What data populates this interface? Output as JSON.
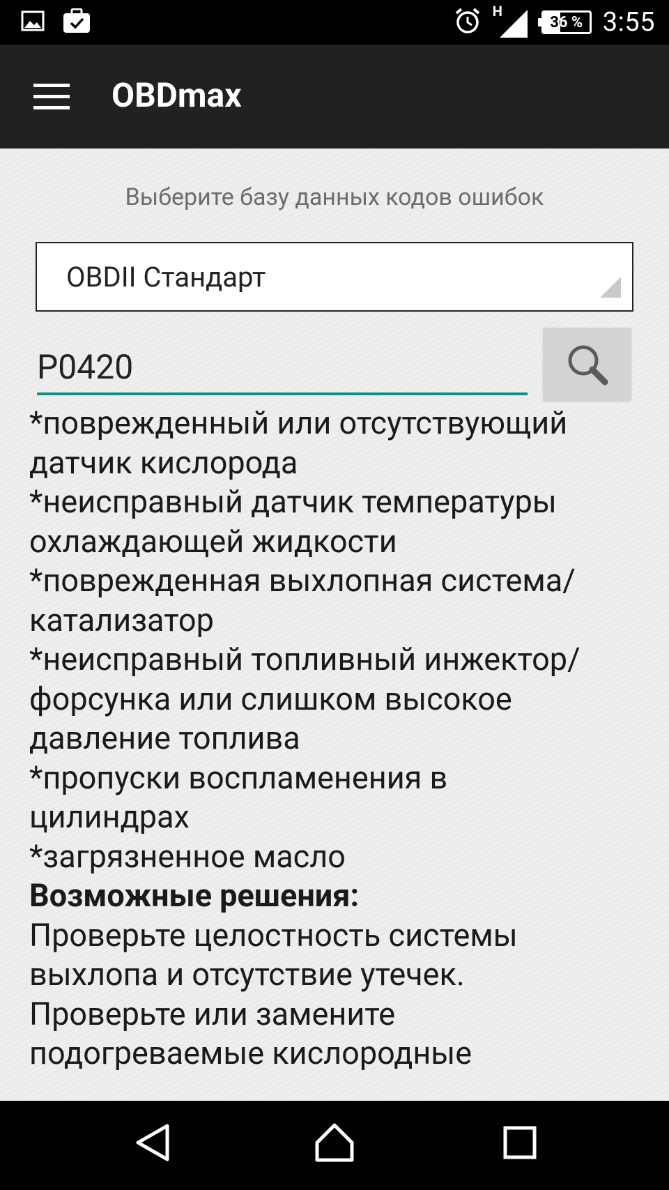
{
  "status_bar": {
    "time": "3:55",
    "battery": "36 %",
    "network_type": "H",
    "icons": [
      "image-icon",
      "briefcase-icon",
      "alarm-icon",
      "signal-icon",
      "battery-icon"
    ]
  },
  "app_bar": {
    "title": "OBDmax",
    "menu_icon": "menu-icon"
  },
  "main": {
    "db_label": "Выберите базу данных кодов ошибок",
    "database_select": {
      "value": "OBDII Стандарт"
    },
    "code_input": {
      "value": "P0420"
    },
    "search_icon": "search-icon",
    "description_lines": [
      "*поврежденный или отсутствующий",
      "датчик кислорода",
      "*неисправный датчик температуры",
      "охлаждающей жидкости",
      "*поврежденная выхлопная система/",
      "катализатор",
      "*неисправный топливный инжектор/",
      "форсунка или слишком высокое",
      "давление топлива",
      "*пропуски воспламенения в",
      "цилиндрах",
      "*загрязненное масло"
    ],
    "solutions_heading": "Возможные решения:",
    "solution_lines": [
      "Проверьте целостность системы",
      "выхлопа и отсутствие утечек.",
      "Проверьте или замените",
      "подогреваемые кислородные"
    ]
  },
  "nav_bar": {
    "icons": [
      "back-icon",
      "home-icon",
      "recents-icon"
    ]
  },
  "colors": {
    "accent": "#138e82",
    "app_bar": "#212121",
    "background": "#ebebeb"
  }
}
